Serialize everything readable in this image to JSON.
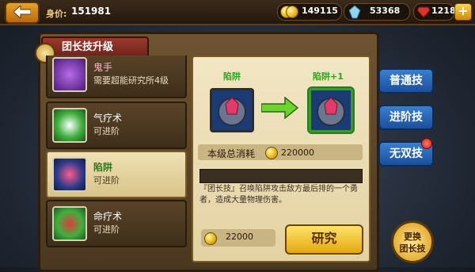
{
  "top_bar": {
    "worth_label": "身价:",
    "worth_value": "151981",
    "gold_value": "149115",
    "crystal_value": "53368",
    "gem_value": "1218",
    "plus_label": "+"
  },
  "panel": {
    "title": "团长技升级"
  },
  "skills": [
    {
      "name": "鬼手",
      "status": "需要超能研究所4级"
    },
    {
      "name": "气疗术",
      "status": "可进阶"
    },
    {
      "name": "陷阱",
      "status": "可进阶"
    },
    {
      "name": "命疗术",
      "status": "可进阶"
    }
  ],
  "detail": {
    "current_label": "陷阱",
    "next_label": "陷阱+1",
    "cost_label": "本级总消耗",
    "cost_value": "220000",
    "description": "『团长技』召唤陷阱攻击敌方最后排的一个勇者，造成大量物理伤害。",
    "price_value": "22000",
    "research_label": "研究"
  },
  "side_tabs": {
    "normal": "普通技",
    "advanced": "进阶技",
    "ultimate": "无双技",
    "swap_line1": "更换",
    "swap_line2": "团长技"
  },
  "colors": {
    "accent_green": "#2aa81e",
    "tab_blue": "#1c4f9b",
    "gold": "#e5b20f"
  }
}
